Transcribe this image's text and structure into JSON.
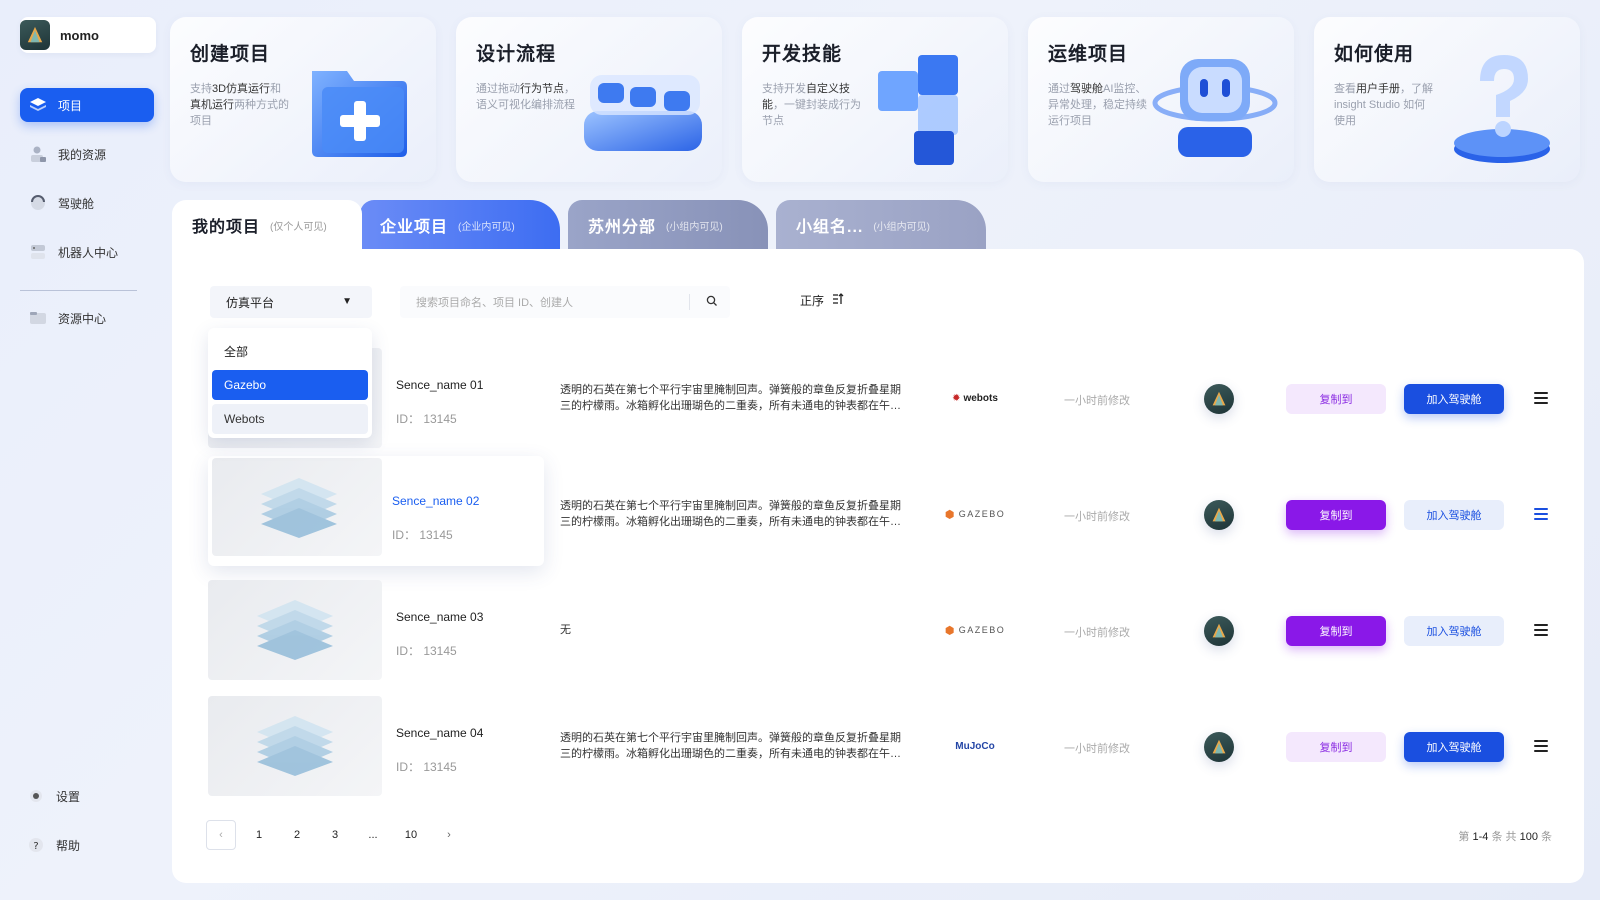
{
  "user": {
    "name": "momo"
  },
  "sidebar": {
    "items": [
      {
        "label": "项目"
      },
      {
        "label": "我的资源"
      },
      {
        "label": "驾驶舱"
      },
      {
        "label": "机器人中心"
      },
      {
        "label": "资源中心"
      }
    ],
    "settings": "设置",
    "help": "帮助"
  },
  "features": [
    {
      "title": "创建项目",
      "desc_parts": [
        "支持",
        "3D仿真运行",
        "和",
        "真机运行",
        "两种方式的项目"
      ],
      "icon": "folder-plus-icon"
    },
    {
      "title": "设计流程",
      "desc_parts": [
        "通过拖动",
        "行为节点",
        "，语义可视化编排流程"
      ],
      "icon": "flow-blocks-icon"
    },
    {
      "title": "开发技能",
      "desc_parts": [
        "支持开发",
        "自定义技能",
        "，一键封装成行为节点"
      ],
      "icon": "cubes-icon"
    },
    {
      "title": "运维项目",
      "desc_parts": [
        "通过",
        "驾驶舱",
        "AI监控、异常处理，稳定持续运行项目"
      ],
      "icon": "robot-icon"
    },
    {
      "title": "如何使用",
      "desc_parts": [
        "查看",
        "用户手册",
        "，了解 insight Studio 如何使用"
      ],
      "icon": "question-icon"
    }
  ],
  "tabs": [
    {
      "name": "我的项目",
      "note": "(仅个人可见)"
    },
    {
      "name": "企业项目",
      "note": "(企业内可见)"
    },
    {
      "name": "苏州分部",
      "note": "(小组内可见)"
    },
    {
      "name": "小组名...",
      "note": "(小组内可见)"
    }
  ],
  "filter": {
    "selected": "仿真平台",
    "options": [
      "全部",
      "Gazebo",
      "Webots"
    ],
    "search_placeholder": "搜索项目命名、项目 ID、创建人",
    "sort_label": "正序"
  },
  "rows": [
    {
      "name": "Sence_name 01",
      "id": "ID： 13145",
      "desc": "透明的石英在第七个平行宇宙里腌制回声。弹簧般的章鱼反复折叠星期三的柠檬雨。冰箱孵化出珊瑚色的二重奏，所有未通电的钟表都在午夜低语。",
      "platform": "webots",
      "modified": "一小时前修改",
      "copy": "复制到",
      "join": "加入驾驶舱"
    },
    {
      "name": "Sence_name 02",
      "id": "ID： 13145",
      "desc": "透明的石英在第七个平行宇宙里腌制回声。弹簧般的章鱼反复折叠星期三的柠檬雨。冰箱孵化出珊瑚色的二重奏，所有未通电的钟表都在午夜低语。",
      "platform": "GAZEBO",
      "modified": "一小时前修改",
      "copy": "复制到",
      "join": "加入驾驶舱"
    },
    {
      "name": "Sence_name 03",
      "id": "ID： 13145",
      "desc": "无",
      "platform": "GAZEBO",
      "modified": "一小时前修改",
      "copy": "复制到",
      "join": "加入驾驶舱"
    },
    {
      "name": "Sence_name 04",
      "id": "ID： 13145",
      "desc": "透明的石英在第七个平行宇宙里腌制回声。弹簧般的章鱼反复折叠星期三的柠檬雨。冰箱孵化出珊瑚色的二重奏，所有未通电的钟表都在午夜低语。",
      "platform": "MuJoCo",
      "modified": "一小时前修改",
      "copy": "复制到",
      "join": "加入驾驶舱"
    }
  ],
  "pagination": {
    "prev": "‹",
    "pages": [
      "1",
      "2",
      "3",
      "...",
      "10"
    ],
    "next": "›",
    "total_prefix": "第",
    "range": "1-4",
    "mid": "条  共",
    "count": "100",
    "suffix": "条"
  },
  "colors": {
    "primary": "#1a5ef0",
    "purple": "#8a18e8",
    "bg": "#e9eefb"
  }
}
